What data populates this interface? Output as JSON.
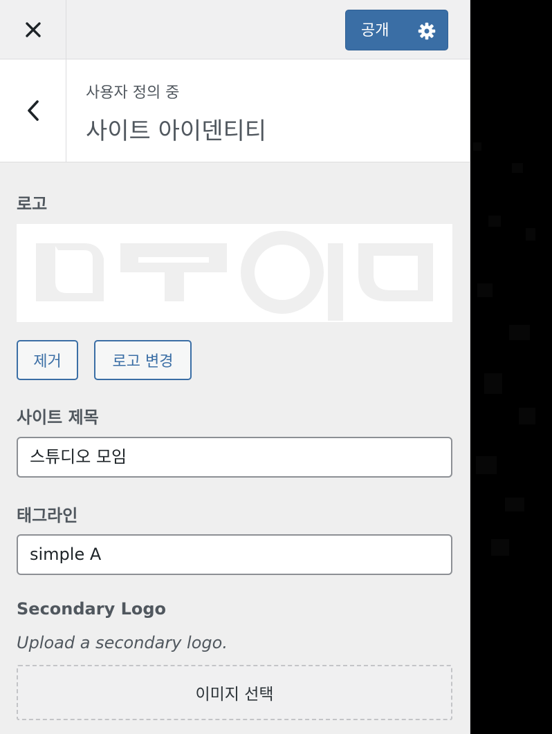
{
  "header": {
    "publish_label": "공개"
  },
  "section": {
    "breadcrumb": "사용자 정의 중",
    "title": "사이트 아이덴티티"
  },
  "logo": {
    "label": "로고",
    "remove_label": "제거",
    "change_label": "로고 변경"
  },
  "site_title": {
    "label": "사이트 제목",
    "value": "스튜디오 모임"
  },
  "tagline": {
    "label": "태그라인",
    "value": "simple A"
  },
  "secondary_logo": {
    "label": "Secondary Logo",
    "description": "Upload a secondary logo.",
    "select_label": "이미지 선택"
  },
  "colors": {
    "accent": "#3a6ea5",
    "panel_bg": "#efefef",
    "preview_bg": "#000000"
  }
}
